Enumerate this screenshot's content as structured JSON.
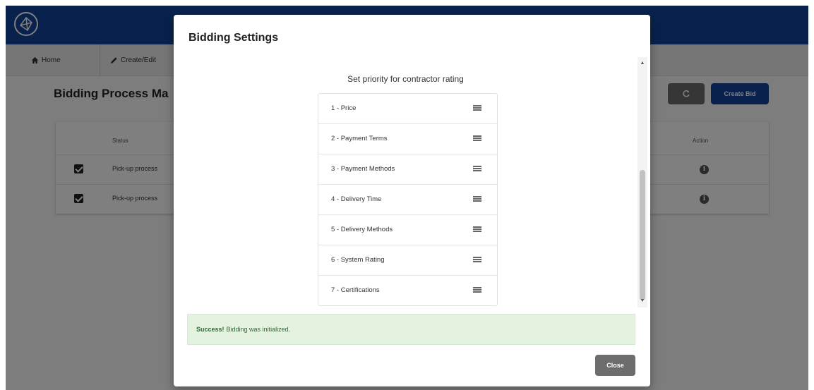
{
  "nav": {
    "home_label": "Home",
    "create_label": "Create/Edit"
  },
  "page": {
    "title": "Bidding Process Ma",
    "create_bid_label": "Create Bid"
  },
  "table": {
    "status_header": "Status",
    "action_header": "Action",
    "rows": [
      {
        "status": "Pick-up process",
        "checked": true
      },
      {
        "status": "Pick-up process",
        "checked": true
      }
    ]
  },
  "modal": {
    "title": "Bidding Settings",
    "priority_heading": "Set priority for contractor rating",
    "priorities": [
      {
        "label": "1 - Price"
      },
      {
        "label": "2 - Payment Terms"
      },
      {
        "label": "3 - Payment Methods"
      },
      {
        "label": "4 - Delivery Time"
      },
      {
        "label": "5 - Delivery Methods"
      },
      {
        "label": "6 - System Rating"
      },
      {
        "label": "7 - Certifications"
      }
    ],
    "alert_strong": "Success!",
    "alert_text": "Bidding was initialized.",
    "close_label": "Close"
  },
  "colors": {
    "brand": "#12449a",
    "secondary_button": "#6d6d6d",
    "success_bg": "#e3f3df"
  }
}
